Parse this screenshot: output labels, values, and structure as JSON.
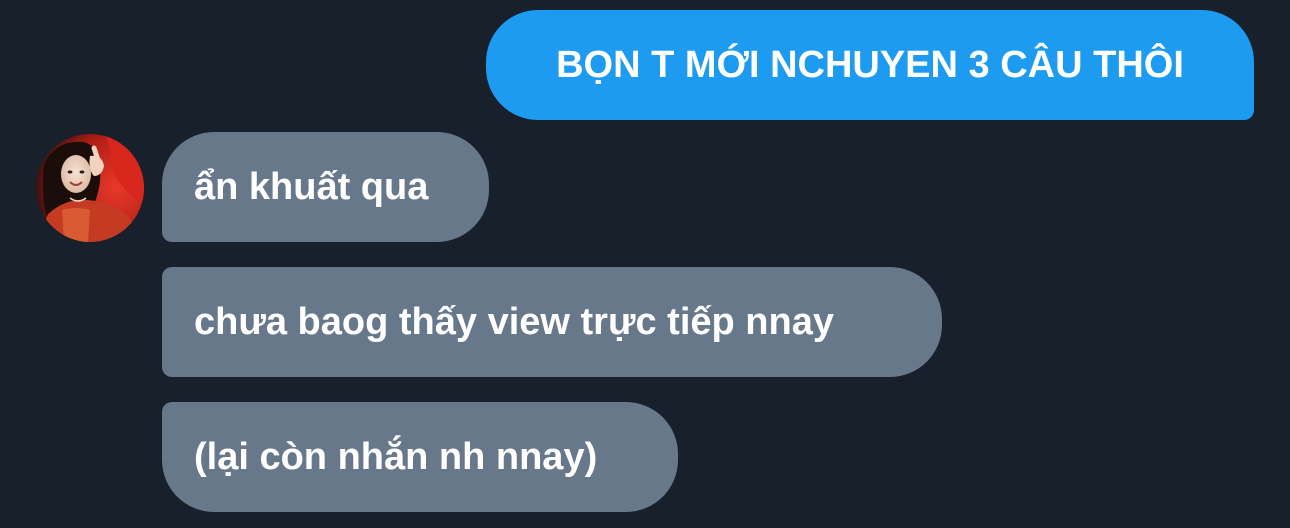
{
  "thread": {
    "outgoing": [
      {
        "text": "BỌN T MỚI NCHUYEN 3 CÂU THÔI"
      }
    ],
    "incoming": [
      {
        "text": "ẩn khuất qua"
      },
      {
        "text": "chưa baog thấy view trực tiếp nnay"
      },
      {
        "text": "(lại còn nhắn nh nnay)"
      }
    ],
    "contact": {
      "avatar_icon": "user-photo-avatar"
    }
  },
  "colors": {
    "background": "#17202b",
    "outgoing_bubble": "#1d9bf0",
    "incoming_bubble": "#66788a",
    "text": "#ffffff"
  }
}
